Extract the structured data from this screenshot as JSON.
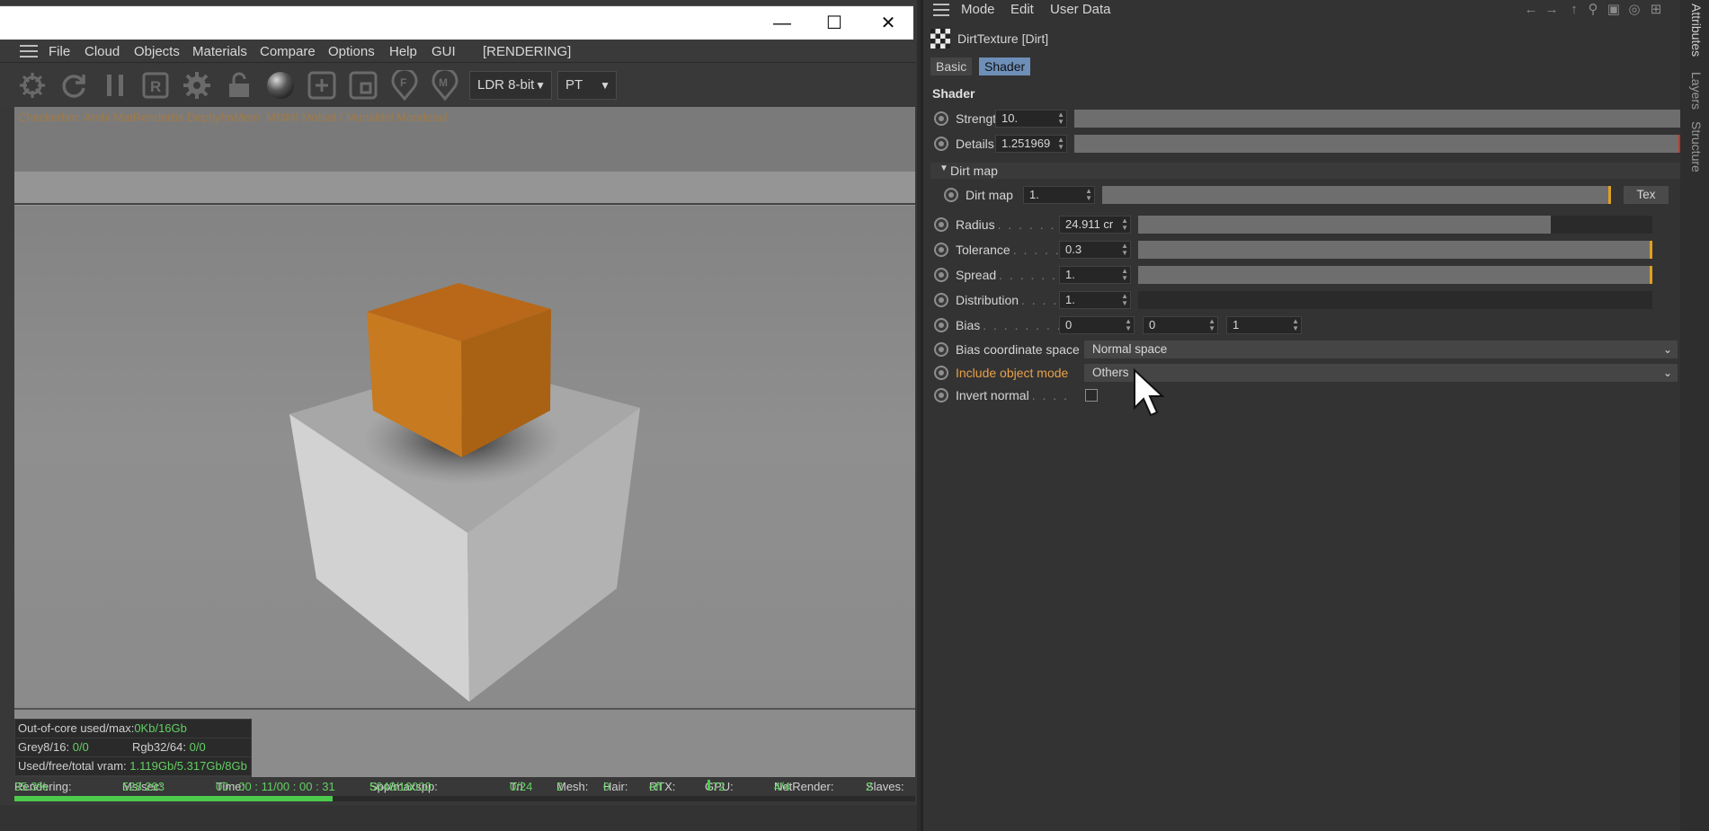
{
  "left_window": {
    "menu": [
      "File",
      "Cloud",
      "Objects",
      "Materials",
      "Compare",
      "Options",
      "Help",
      "GUI",
      "[RENDERING]"
    ],
    "toolbar": {
      "icons": [
        "aperture-icon",
        "refresh-icon",
        "pause-icon",
        "region-icon",
        "gear-icon",
        "lock-icon",
        "sphere-icon",
        "add-camera-icon",
        "add-view-icon",
        "focus-pin-icon",
        "material-pin-icon"
      ],
      "display_mode": "LDR 8-bit",
      "kernel": "PT"
    },
    "render_info": "Checkerbm: Ambi MatRenderbs DepbyfmMem. MMMI Mobiel / Munaldel Mondetail",
    "stats": {
      "ooc_label": "Out-of-core used/max:",
      "ooc_value": "0Kb/16Gb",
      "grey_label": "Grey8/16:",
      "grey_value": "0/0",
      "rgb_label": "Rgb32/64:",
      "rgb_value": "0/0",
      "vram_label": "Used/free/total vram:",
      "vram_value": "1.119Gb/5.317Gb/8Gb"
    },
    "status": {
      "rendering_label": "Rendering:",
      "rendering_value": "35.3%",
      "ms_label": "Ms/sec:",
      "ms_value": "528.293",
      "time_label": "Time:",
      "time_value": "00 : 00 : 11/00 : 00 : 31",
      "spp_label": "Spp/maxspp:",
      "spp_value": "5648/16000",
      "tri_label": "Tri:",
      "tri_value": "0/24",
      "mesh_label": "Mesh:",
      "mesh_value": "2",
      "hair_label": "Hair:",
      "hair_value": "0",
      "rtx_label": "RTX:",
      "rtx_value": "off",
      "gpu_label": "GPU:",
      "gpu_value": "72",
      "net_label": "NetRender:",
      "net_value": "4/4",
      "slaves_label": "Slaves:",
      "slaves_value": "2",
      "progress": 0.353
    }
  },
  "attr": {
    "menu": [
      "Mode",
      "Edit",
      "User Data"
    ],
    "object_name": "DirtTexture [Dirt]",
    "tabs": [
      "Basic",
      "Shader"
    ],
    "section": "Shader",
    "strength": {
      "label": "Strength",
      "value": "10.",
      "fraction": 1.0
    },
    "details": {
      "label": "Details",
      "value": "1.251969",
      "fraction": 1.0
    },
    "group_dirtmap": "Dirt map",
    "dirtmap": {
      "label": "Dirt map",
      "value": "1.",
      "button": "Tex",
      "fraction": 1.0
    },
    "radius": {
      "label": "Radius",
      "value": "24.911 cr",
      "fraction": 0.8
    },
    "tolerance": {
      "label": "Tolerance",
      "value": "0.3",
      "fraction": 1.0
    },
    "spread": {
      "label": "Spread",
      "value": "1.",
      "fraction": 1.0
    },
    "distribution": {
      "label": "Distribution",
      "value": "1.",
      "fraction": 0.0
    },
    "bias": {
      "label": "Bias",
      "x": "0",
      "y": "0",
      "z": "1"
    },
    "bias_space": {
      "label": "Bias coordinate space",
      "value": "Normal space"
    },
    "include_mode": {
      "label": "Include object mode",
      "value": "Others",
      "color": "#e8a04a"
    },
    "invert_normal": {
      "label": "Invert normal"
    }
  },
  "side_tabs": [
    "Attributes",
    "Layers",
    "Structure"
  ],
  "colors": {
    "accent": "#6d8fb8",
    "progress": "#4ccb4c",
    "marker": "#e0a020",
    "orange": "#e8a04a"
  }
}
